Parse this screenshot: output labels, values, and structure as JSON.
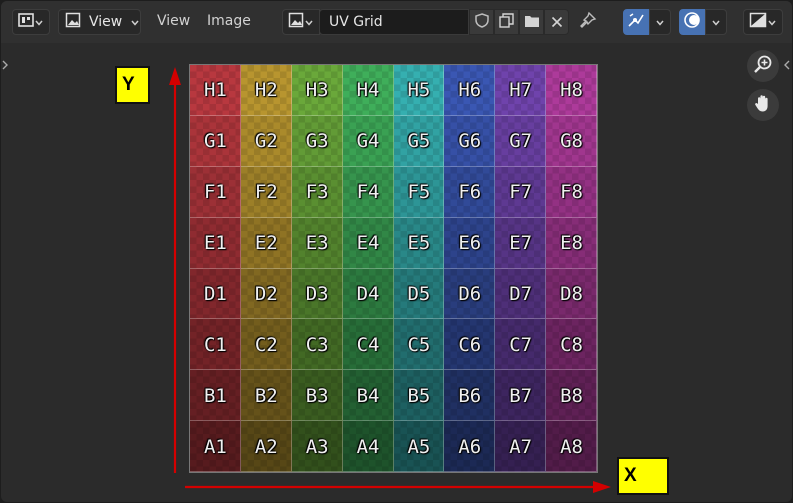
{
  "header": {
    "view_menu_label": "View",
    "menus": [
      "View",
      "Image"
    ],
    "image_name": "UV Grid"
  },
  "accent_color": "#4772b3",
  "annotations": {
    "x_label": "X",
    "y_label": "Y",
    "arrow_color": "#d40000",
    "label_bg": "#ffff00"
  },
  "uv_grid": {
    "rows": [
      "H",
      "G",
      "F",
      "E",
      "D",
      "C",
      "B",
      "A"
    ],
    "columns": [
      "1",
      "2",
      "3",
      "4",
      "5",
      "6",
      "7",
      "8"
    ],
    "column_colors": [
      "#b8383f",
      "#b8952f",
      "#6aa83a",
      "#3fae5a",
      "#35afb0",
      "#3a57b3",
      "#6f43ac",
      "#ad3a9a"
    ]
  }
}
